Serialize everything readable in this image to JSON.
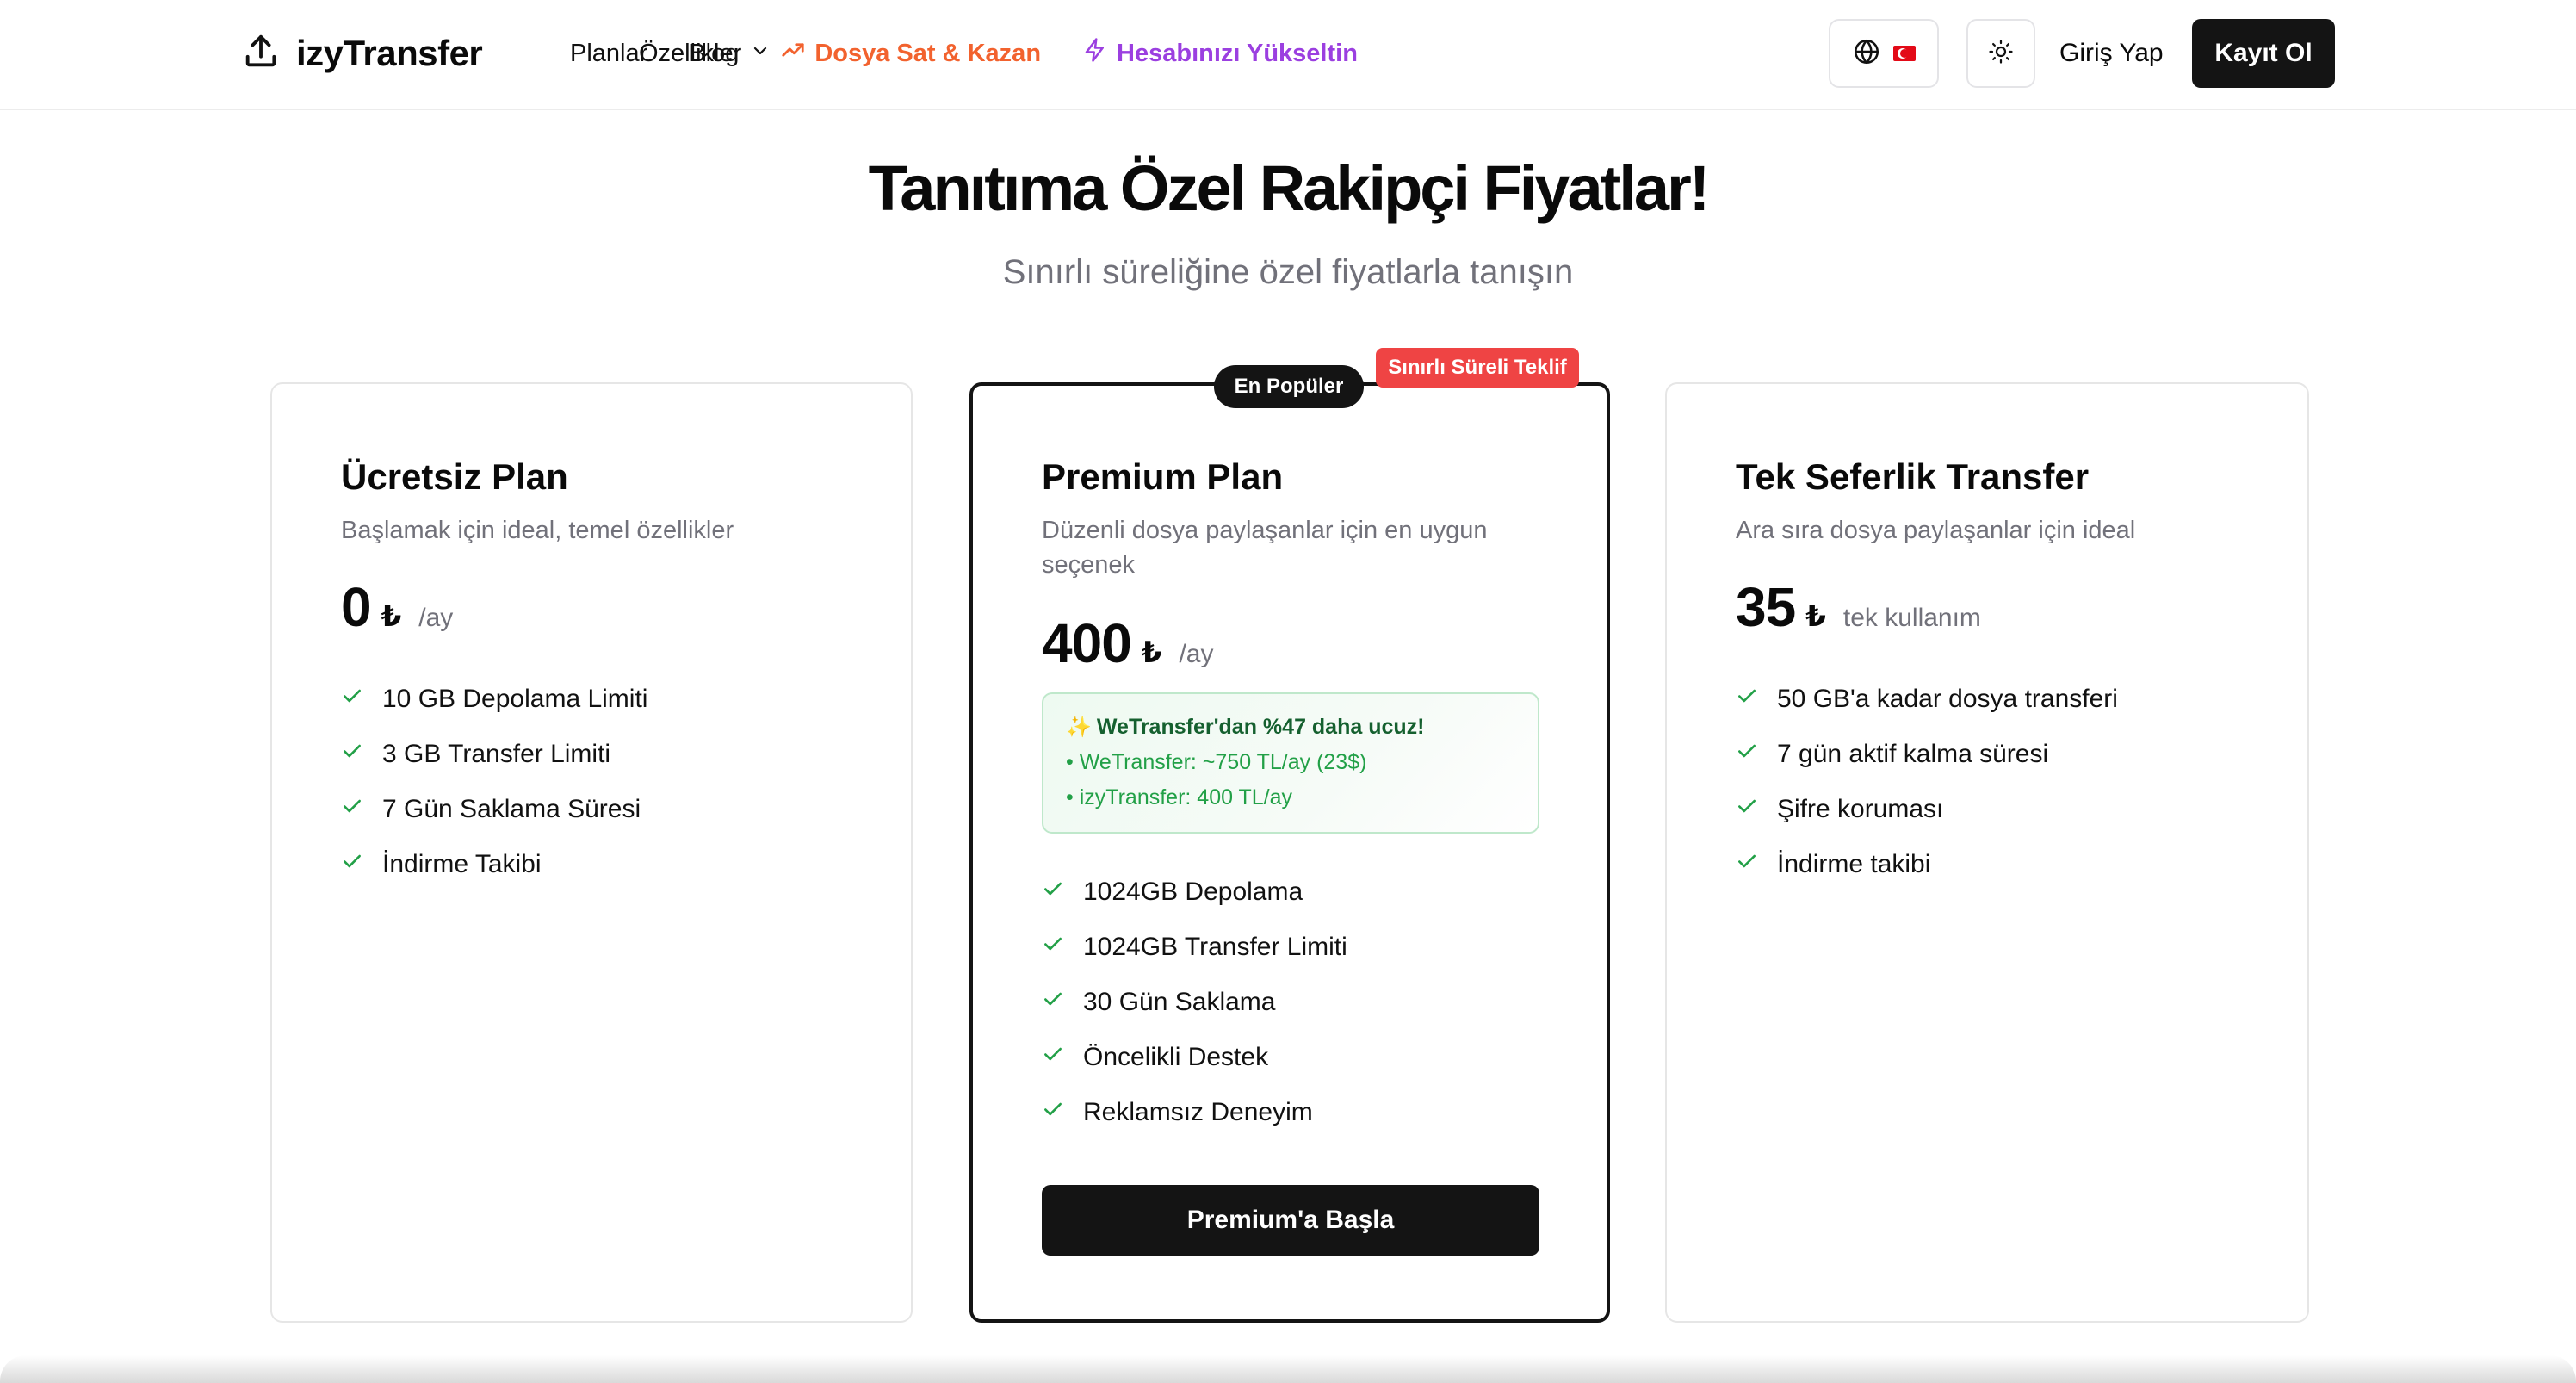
{
  "brand": {
    "name": "izyTransfer",
    "icon": "upload-icon"
  },
  "nav": {
    "features": "Özellikler",
    "plans": "Planlar",
    "blog": "Blog",
    "sell": "Dosya Sat & Kazan",
    "upgrade": "Hesabınızı Yükseltin",
    "login": "Giriş Yap",
    "signup": "Kayıt Ol",
    "sell_color": "#f2622e",
    "upgrade_color": "#9b3fe0"
  },
  "hero": {
    "title": "Tanıtıma Özel Rakipçi Fiyatlar!",
    "subtitle": "Sınırlı süreliğine özel fiyatlarla tanışın"
  },
  "plans": {
    "free": {
      "title": "Ücretsiz Plan",
      "description": "Başlamak için ideal, temel özellikler",
      "price": "0",
      "currency": "₺",
      "period": "/ay",
      "features": [
        "10 GB Depolama Limiti",
        "3 GB Transfer Limiti",
        "7 Gün Saklama Süresi",
        "İndirme Takibi"
      ]
    },
    "premium": {
      "badge_popular": "En Popüler",
      "badge_limited": "Sınırlı Süreli Teklif",
      "title": "Premium Plan",
      "description": "Düzenli dosya paylaşanlar için en uygun seçenek",
      "price": "400",
      "currency": "₺",
      "period": "/ay",
      "compare": {
        "headline": "WeTransfer'dan %47 daha ucuz!",
        "line1": "• WeTransfer: ~750 TL/ay (23$)",
        "line2": "• izyTransfer: 400 TL/ay"
      },
      "features": [
        "1024GB Depolama",
        "1024GB Transfer Limiti",
        "30 Gün Saklama",
        "Öncelikli Destek",
        "Reklamsız Deneyim"
      ],
      "cta": "Premium'a Başla"
    },
    "single": {
      "title": "Tek Seferlik Transfer",
      "description": "Ara sıra dosya paylaşanlar için ideal",
      "price": "35",
      "currency": "₺",
      "period": "tek kullanım",
      "features": [
        "50 GB'a kadar dosya transferi",
        "7 gün aktif kalma süresi",
        "Şifre koruması",
        "İndirme takibi"
      ]
    }
  },
  "colors": {
    "check": "#22a047",
    "accent_dark": "#141414",
    "badge_red": "#ef4444"
  }
}
